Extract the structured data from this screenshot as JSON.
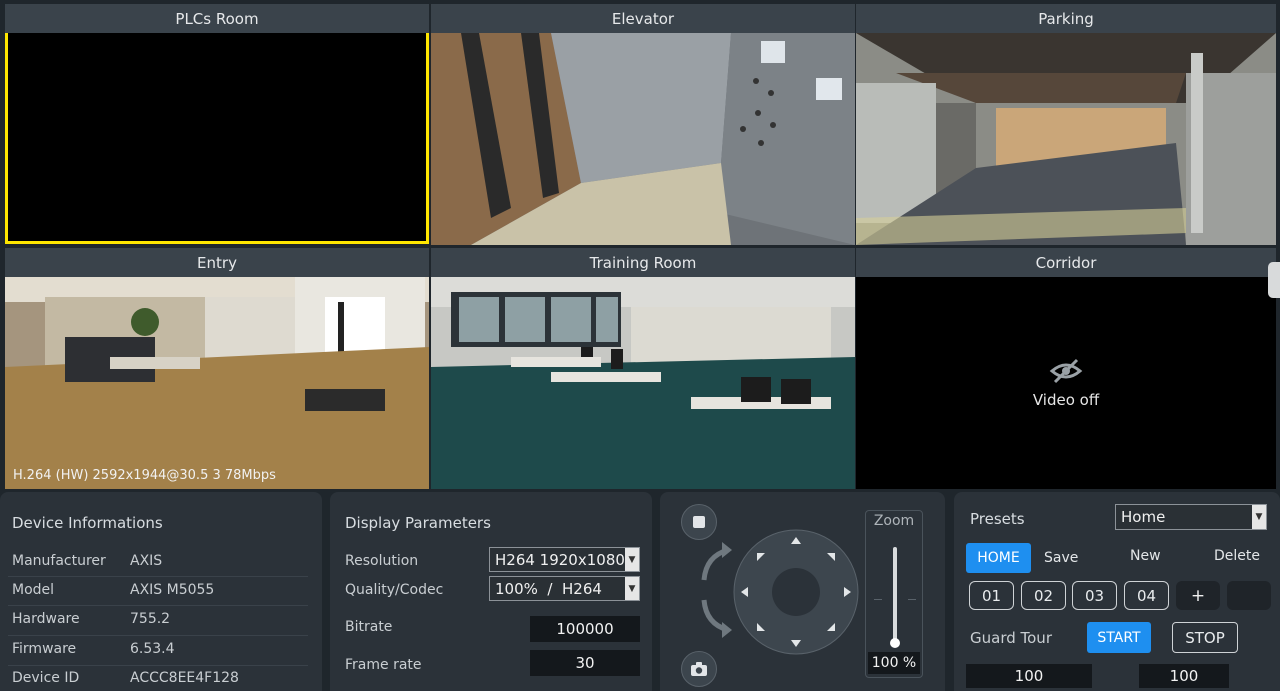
{
  "cameras": [
    {
      "title": "PLCs Room"
    },
    {
      "title": "Elevator"
    },
    {
      "title": "Parking"
    },
    {
      "title": "Entry",
      "overlay": "H.264 (HW) 2592x1944@30.5 3 78Mbps"
    },
    {
      "title": "Training Room"
    },
    {
      "title": "Corridor",
      "status": "Video off"
    }
  ],
  "device": {
    "title": "Device Informations",
    "rows": [
      {
        "label": "Manufacturer",
        "value": "AXIS"
      },
      {
        "label": "Model",
        "value": "AXIS M5055"
      },
      {
        "label": "Hardware",
        "value": "755.2"
      },
      {
        "label": "Firmware",
        "value": "6.53.4"
      },
      {
        "label": "Device ID",
        "value": "ACCC8EE4F128"
      }
    ]
  },
  "display": {
    "title": "Display Parameters",
    "resolution_label": "Resolution",
    "resolution_value": "H264 1920x1080",
    "quality_label": "Quality/Codec",
    "quality_value": "100%  /  H264",
    "bitrate_label": "Bitrate",
    "bitrate_value": "100000",
    "framerate_label": "Frame rate",
    "framerate_value": "30"
  },
  "ptz": {
    "zoom_label": "Zoom",
    "zoom_value": "100 %",
    "zoom_level_percent": 100
  },
  "presets": {
    "title": "Presets",
    "selected": "Home",
    "home_label": "HOME",
    "save_label": "Save",
    "new_label": "New",
    "delete_label": "Delete",
    "slots": [
      "01",
      "02",
      "03",
      "04"
    ],
    "add_label": "+",
    "guard_tour_label": "Guard Tour",
    "start_label": "START",
    "stop_label": "STOP",
    "value_1": "100",
    "value_2": "100"
  },
  "colors": {
    "accent": "#1e8ff0",
    "selected_border": "#ffe600",
    "panel_bg": "#2b3239"
  }
}
